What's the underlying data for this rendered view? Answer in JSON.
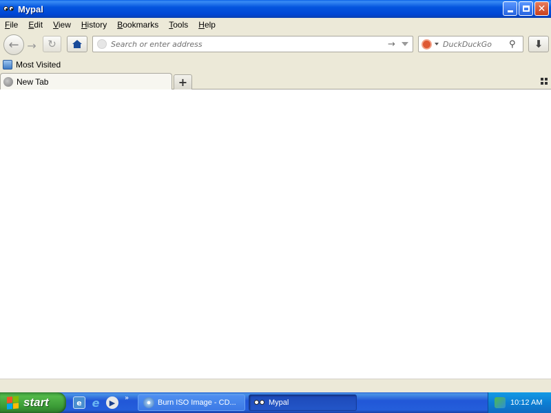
{
  "window": {
    "title": "Mypal"
  },
  "menu": [
    {
      "first": "F",
      "rest": "ile"
    },
    {
      "first": "E",
      "rest": "dit"
    },
    {
      "first": "V",
      "rest": "iew"
    },
    {
      "first": "H",
      "rest": "istory"
    },
    {
      "first": "B",
      "rest": "ookmarks"
    },
    {
      "first": "T",
      "rest": "ools"
    },
    {
      "first": "H",
      "rest": "elp"
    }
  ],
  "toolbar": {
    "url_placeholder": "Search or enter address",
    "search_placeholder": "DuckDuckGo"
  },
  "bookmarks": {
    "most_visited": "Most Visited"
  },
  "tabs": {
    "current": "New Tab"
  },
  "taskbar": {
    "start_label": "start",
    "tasks": [
      "Burn ISO Image - CD...",
      "Mypal"
    ],
    "clock": "10:12 AM"
  },
  "colors": {
    "titlebar": "#0046d5",
    "start_green": "#3a9a36",
    "taskbar_blue": "#245edb",
    "tray_blue": "#0c7fd4"
  },
  "icons": [
    "mypal-icon",
    "back-arrow-icon",
    "forward-arrow-icon",
    "reload-icon",
    "home-icon",
    "globe-icon",
    "go-arrow-icon",
    "dropdown-icon",
    "duckduckgo-icon",
    "search-glass-icon",
    "download-icon",
    "bookmark-icon",
    "new-tab-plus-icon",
    "tab-grid-icon",
    "windows-logo-icon",
    "burn-disc-icon",
    "network-tray-icon"
  ]
}
